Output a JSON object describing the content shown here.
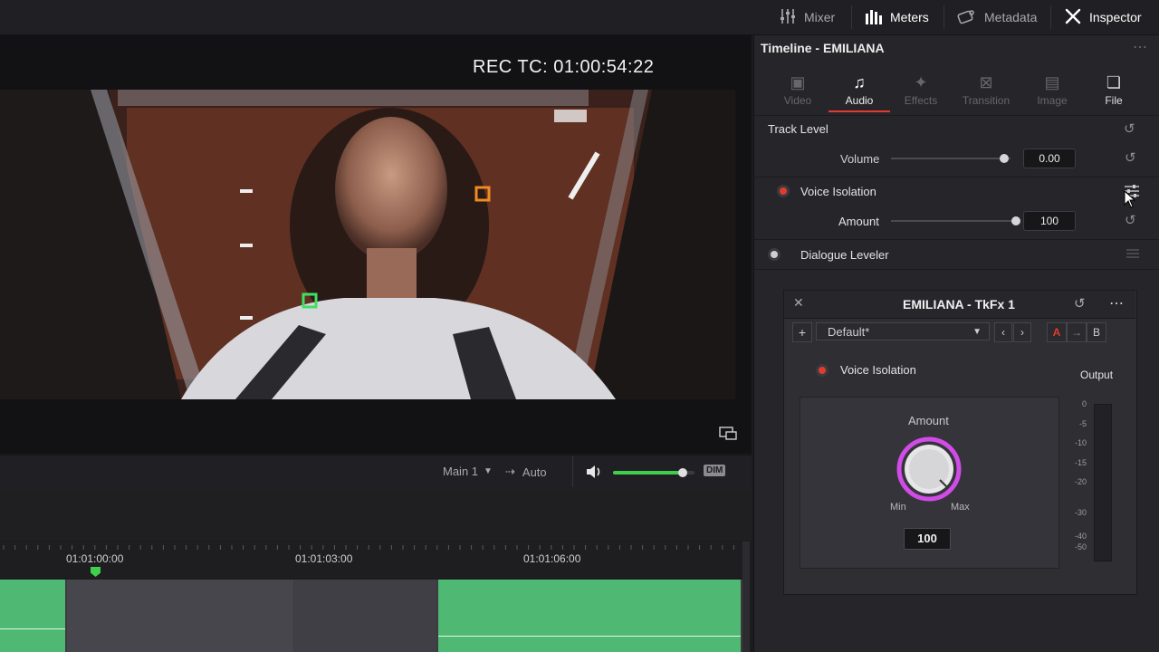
{
  "topbar": {
    "mixer": "Mixer",
    "meters": "Meters",
    "metadata": "Metadata",
    "inspector": "Inspector"
  },
  "viewer": {
    "rec_tc": "REC TC: 01:00:54:22",
    "output_label": "Main 1",
    "route_label": "Auto",
    "dim_label": "DIM",
    "volume_level": 0.85
  },
  "timeline": {
    "ticks": [
      "01:01:00:00",
      "01:01:03:00",
      "01:01:06:00"
    ]
  },
  "inspector": {
    "title": "Timeline - EMILIANA",
    "tabs": [
      {
        "label": "Video",
        "icon": "film-icon"
      },
      {
        "label": "Audio",
        "icon": "music-note-icon"
      },
      {
        "label": "Effects",
        "icon": "wand-icon"
      },
      {
        "label": "Transition",
        "icon": "transition-icon"
      },
      {
        "label": "Image",
        "icon": "image-icon"
      },
      {
        "label": "File",
        "icon": "files-icon"
      }
    ],
    "track_level": {
      "heading": "Track Level",
      "volume_label": "Volume",
      "volume_value": "0.00"
    },
    "voice_isolation": {
      "label": "Voice Isolation",
      "amount_label": "Amount",
      "amount_value": "100"
    },
    "dialogue_leveler": {
      "label": "Dialogue Leveler"
    }
  },
  "plugin": {
    "title": "EMILIANA - TkFx 1",
    "preset": "Default*",
    "ab_a": "A",
    "ab_b": "B",
    "effect_label": "Voice Isolation",
    "output_label": "Output",
    "knob_label": "Amount",
    "min_label": "Min",
    "max_label": "Max",
    "knob_value": "100",
    "meter_scale": [
      "0",
      "-5",
      "-10",
      "-15",
      "-20",
      "-30",
      "-40",
      "-50"
    ]
  },
  "colors": {
    "accent_red": "#e23b2e",
    "clip_green": "#4fb873",
    "knob_ring": "#d14be6"
  }
}
